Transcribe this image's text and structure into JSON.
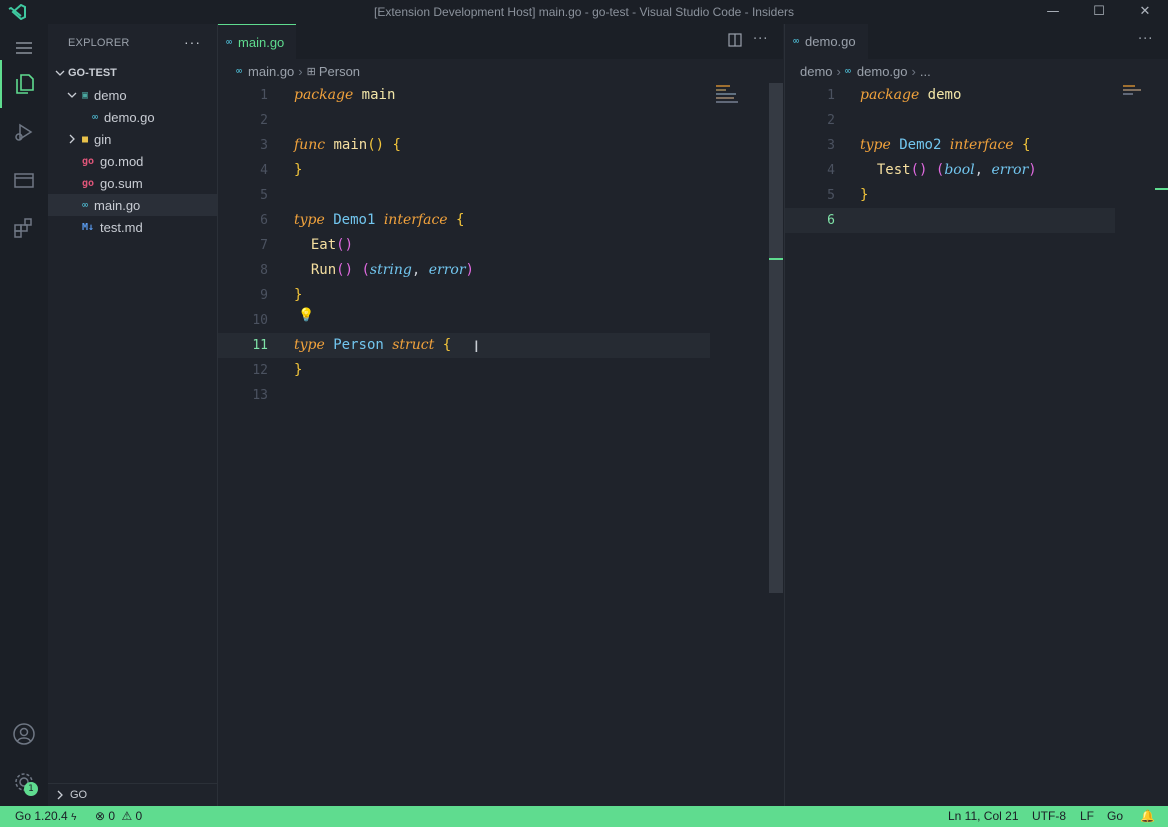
{
  "window": {
    "title": "[Extension Development Host] main.go - go-test - Visual Studio Code - Insiders",
    "minimize": "—",
    "maximize": "☐",
    "close": "✕"
  },
  "sidebar": {
    "title": "EXPLORER",
    "more": "···",
    "root": "GO-TEST",
    "items": [
      {
        "label": "demo",
        "icon": "folder-icon",
        "icon_glyph": "▣",
        "icon_color": "#4aa8a0"
      },
      {
        "label": "demo.go",
        "icon": "go-file-icon",
        "icon_glyph": "∞",
        "icon_color": "#52c7e0"
      },
      {
        "label": "gin",
        "icon": "folder-icon",
        "icon_glyph": "■",
        "icon_color": "#e8c14a"
      },
      {
        "label": "go.mod",
        "icon": "go-mod-icon",
        "icon_glyph": "go",
        "icon_color": "#e0567a"
      },
      {
        "label": "go.sum",
        "icon": "go-sum-icon",
        "icon_glyph": "go",
        "icon_color": "#e0567a"
      },
      {
        "label": "main.go",
        "icon": "go-file-icon",
        "icon_glyph": "∞",
        "icon_color": "#52c7e0"
      },
      {
        "label": "test.md",
        "icon": "markdown-icon",
        "icon_glyph": "M↓",
        "icon_color": "#5a9cf0"
      }
    ],
    "outline_label": "GO"
  },
  "editor1": {
    "tab": "main.go",
    "crumbs": [
      "main.go",
      "Person"
    ],
    "lines": [
      {
        "n": "1",
        "tokens": [
          [
            "kw",
            "package"
          ],
          [
            "sp",
            " "
          ],
          [
            "pk",
            "main"
          ]
        ]
      },
      {
        "n": "2",
        "tokens": []
      },
      {
        "n": "3",
        "tokens": [
          [
            "kw",
            "func"
          ],
          [
            "sp",
            " "
          ],
          [
            "fn",
            "main"
          ],
          [
            "br",
            "()"
          ],
          [
            "sp",
            " "
          ],
          [
            "br",
            "{"
          ]
        ]
      },
      {
        "n": "4",
        "tokens": [
          [
            "br",
            "}"
          ]
        ]
      },
      {
        "n": "5",
        "tokens": []
      },
      {
        "n": "6",
        "tokens": [
          [
            "kw",
            "type"
          ],
          [
            "sp",
            " "
          ],
          [
            "ty",
            "Demo1"
          ],
          [
            "sp",
            " "
          ],
          [
            "kw",
            "interface"
          ],
          [
            "sp",
            " "
          ],
          [
            "br",
            "{"
          ]
        ]
      },
      {
        "n": "7",
        "tokens": [
          [
            "sp",
            "  "
          ],
          [
            "fn",
            "Eat"
          ],
          [
            "pr",
            "()"
          ]
        ]
      },
      {
        "n": "8",
        "tokens": [
          [
            "sp",
            "  "
          ],
          [
            "fn",
            "Run"
          ],
          [
            "pr",
            "()"
          ],
          [
            "sp",
            " "
          ],
          [
            "pr",
            "("
          ],
          [
            "bi",
            "string"
          ],
          [
            "sp",
            ", "
          ],
          [
            "bi",
            "error"
          ],
          [
            "pr",
            ")"
          ]
        ]
      },
      {
        "n": "9",
        "tokens": [
          [
            "br",
            "}"
          ]
        ]
      },
      {
        "n": "10",
        "tokens": []
      },
      {
        "n": "11",
        "tokens": [
          [
            "kw",
            "type"
          ],
          [
            "sp",
            " "
          ],
          [
            "ty",
            "Person"
          ],
          [
            "sp",
            " "
          ],
          [
            "kw",
            "struct"
          ],
          [
            "sp",
            " "
          ],
          [
            "br",
            "{"
          ]
        ]
      },
      {
        "n": "12",
        "tokens": [
          [
            "br",
            "}"
          ]
        ]
      },
      {
        "n": "13",
        "tokens": []
      }
    ]
  },
  "editor2": {
    "tab": "demo.go",
    "crumbs": [
      "demo",
      "demo.go",
      "..."
    ],
    "lines": [
      {
        "n": "1",
        "tokens": [
          [
            "kw",
            "package"
          ],
          [
            "sp",
            " "
          ],
          [
            "pk",
            "demo"
          ]
        ]
      },
      {
        "n": "2",
        "tokens": []
      },
      {
        "n": "3",
        "tokens": [
          [
            "kw",
            "type"
          ],
          [
            "sp",
            " "
          ],
          [
            "ty",
            "Demo2"
          ],
          [
            "sp",
            " "
          ],
          [
            "kw",
            "interface"
          ],
          [
            "sp",
            " "
          ],
          [
            "br",
            "{"
          ]
        ]
      },
      {
        "n": "4",
        "tokens": [
          [
            "sp",
            "  "
          ],
          [
            "fn",
            "Test"
          ],
          [
            "pr",
            "()"
          ],
          [
            "sp",
            " "
          ],
          [
            "pr",
            "("
          ],
          [
            "bi",
            "bool"
          ],
          [
            "sp",
            ", "
          ],
          [
            "bi",
            "error"
          ],
          [
            "pr",
            ")"
          ]
        ]
      },
      {
        "n": "5",
        "tokens": [
          [
            "br",
            "}"
          ]
        ]
      },
      {
        "n": "6",
        "tokens": []
      }
    ]
  },
  "status": {
    "go_version": "Go 1.20.4",
    "errors": "0",
    "warnings": "0",
    "position": "Ln 11, Col 21",
    "encoding": "UTF-8",
    "eol": "LF",
    "language": "Go",
    "accent": "#5fdc8f"
  },
  "settings_badge": "1"
}
